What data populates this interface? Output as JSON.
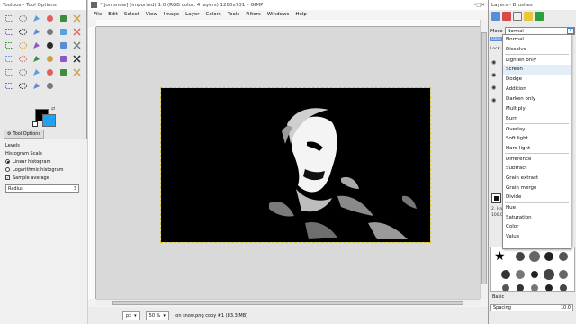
{
  "toolbox": {
    "title": "Toolbox - Tool Options",
    "tool_options_tab": "Tool Options",
    "options": {
      "section": "Levels",
      "histogram_scale": "Histogram Scale",
      "linear": "Linear histogram",
      "logarithmic": "Logarithmic histogram",
      "sample_average": "Sample average",
      "radius_label": "Radius",
      "radius_value": "3"
    },
    "colors": {
      "foreground": "#000000",
      "background": "#1fa3f2"
    }
  },
  "image_window": {
    "title": "*[jon snow] (imported)-1.0 (RGB color, 4 layers) 1280x731 – GIMP",
    "menu": [
      "File",
      "Edit",
      "Select",
      "View",
      "Image",
      "Layer",
      "Colors",
      "Tools",
      "Filters",
      "Windows",
      "Help"
    ],
    "status": {
      "unit": "px",
      "zoom": "50 %",
      "layer_info": "jon snow.png copy #1 (83.3 MB)"
    }
  },
  "dock": {
    "title": "Layers - Brushes",
    "mode_label": "Mode",
    "mode_value": "Normal",
    "side_labels": [
      "Opaci",
      "Lock:"
    ],
    "side_labels_lower": [
      "2. Hard",
      "100.00"
    ],
    "brushes_label": "Basic",
    "spacing_label": "Spacing",
    "spacing_value": "10.0"
  },
  "mode_list": {
    "groups": [
      [
        "Normal",
        "Dissolve"
      ],
      [
        "Lighten only",
        "Screen",
        "Dodge",
        "Addition"
      ],
      [
        "Darken only",
        "Multiply",
        "Burn"
      ],
      [
        "Overlay",
        "Soft light",
        "Hard light"
      ],
      [
        "Difference",
        "Subtract",
        "Grain extract",
        "Grain merge",
        "Divide"
      ],
      [
        "Hue",
        "Saturation",
        "Color",
        "Value"
      ]
    ],
    "highlighted": "Screen"
  }
}
